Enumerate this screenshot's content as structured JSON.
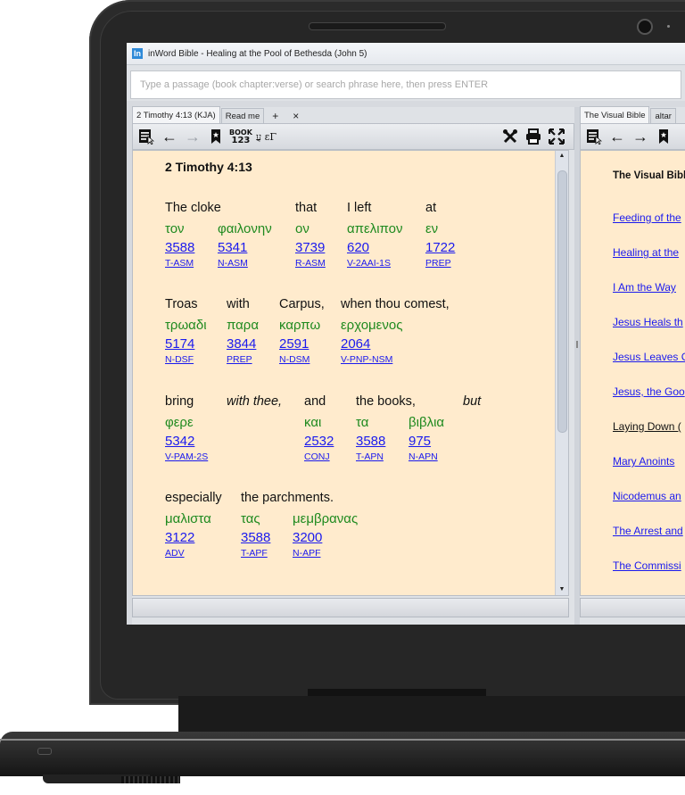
{
  "window": {
    "title": "inWord Bible - Healing at the Pool of Bethesda (John 5)",
    "app_icon": "In"
  },
  "search": {
    "placeholder": "Type a passage (book chapter:verse) or search phrase here, then press ENTER",
    "value": ""
  },
  "left_pane": {
    "tabs": [
      {
        "label": "2 Timothy 4:13 (KJA)",
        "active": true
      },
      {
        "label": "Read me",
        "active": false
      }
    ],
    "add_tab": "+",
    "close_tab": "×",
    "toolbar": {
      "book_label_top": "BOOK",
      "book_label_bottom": "123",
      "hebrew_greek_label": "עֲ εΓ"
    },
    "reference": "2 Timothy 4:13",
    "verses": [
      {
        "words": [
          {
            "english": "The cloke",
            "greek": "τον",
            "strong": "3588",
            "morph": "T-ASM"
          },
          {
            "english": "",
            "greek": "φαιλονην",
            "strong": "5341",
            "morph": "N-ASM"
          },
          {
            "english": "that",
            "greek": "ον",
            "strong": "3739",
            "morph": "R-ASM"
          },
          {
            "english": "I left",
            "greek": "απελιπον",
            "strong": "620",
            "morph": "V-2AAI-1S"
          },
          {
            "english": "at",
            "greek": "εν",
            "strong": "1722",
            "morph": "PREP"
          }
        ]
      },
      {
        "words": [
          {
            "english": "Troas",
            "greek": "τρωαδι",
            "strong": "5174",
            "morph": "N-DSF"
          },
          {
            "english": "with",
            "greek": "παρα",
            "strong": "3844",
            "morph": "PREP"
          },
          {
            "english": "Carpus,",
            "greek": "καρπω",
            "strong": "2591",
            "morph": "N-DSM"
          },
          {
            "english": "when thou comest,",
            "greek": "ερχομενος",
            "strong": "2064",
            "morph": "V-PNP-NSM"
          }
        ]
      },
      {
        "words": [
          {
            "english": "bring",
            "greek": "φερε",
            "strong": "5342",
            "morph": "V-PAM-2S"
          },
          {
            "english": "with thee,",
            "italic": true,
            "greek": "",
            "strong": "",
            "morph": ""
          },
          {
            "english": "and",
            "greek": "και",
            "strong": "2532",
            "morph": "CONJ"
          },
          {
            "english": "the books,",
            "greek": "τα",
            "strong": "3588",
            "morph": "T-APN"
          },
          {
            "english": "",
            "greek": "βιβλια",
            "strong": "975",
            "morph": "N-APN"
          },
          {
            "english": "but",
            "italic": true,
            "greek": "",
            "strong": "",
            "morph": ""
          }
        ]
      },
      {
        "words": [
          {
            "english": "especially",
            "greek": "μαλιστα",
            "strong": "3122",
            "morph": "ADV"
          },
          {
            "english": "the parchments.",
            "greek": "τας",
            "strong": "3588",
            "morph": "T-APF"
          },
          {
            "english": "",
            "greek": "μεμβρανας",
            "strong": "3200",
            "morph": "N-APF"
          }
        ]
      }
    ]
  },
  "right_pane": {
    "tabs": [
      {
        "label": "The Visual Bible",
        "active": true
      },
      {
        "label": "altar",
        "active": false
      }
    ],
    "title": "The Visual Bible",
    "items": [
      {
        "label": "Feeding of the",
        "link": true
      },
      {
        "label": "Healing at the",
        "link": true
      },
      {
        "label": "I Am the Way",
        "link": true
      },
      {
        "label": "Jesus Heals th",
        "link": true
      },
      {
        "label": "Jesus Leaves C",
        "link": true
      },
      {
        "label": "Jesus, the Goo",
        "link": true
      },
      {
        "label": "Laying Down (",
        "link": false
      },
      {
        "label": "Mary Anoints",
        "link": true
      },
      {
        "label": "Nicodemus an",
        "link": true
      },
      {
        "label": "The Arrest and",
        "link": true
      },
      {
        "label": "The Commissi",
        "link": true
      }
    ]
  },
  "colors": {
    "content_bg": "#ffebcd",
    "greek": "#1f8a1f",
    "link": "#1a1aee",
    "app_icon": "#2f8ad8"
  }
}
